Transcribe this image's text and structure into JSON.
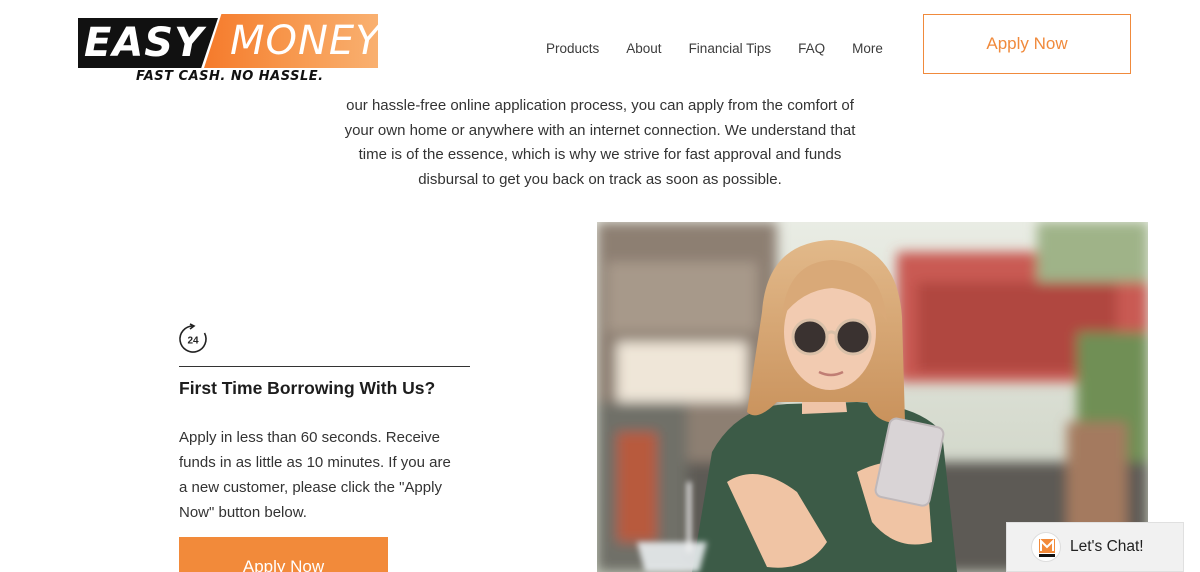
{
  "brand": {
    "logo_word1": "EASY",
    "logo_word2": "MONEY",
    "tagline": "FAST CASH. NO HASSLE.",
    "accent_color": "#f28a3a"
  },
  "nav": {
    "items": [
      {
        "label": "Products"
      },
      {
        "label": "About"
      },
      {
        "label": "Financial Tips"
      },
      {
        "label": "FAQ"
      },
      {
        "label": "More"
      }
    ]
  },
  "header": {
    "apply_label": "Apply Now"
  },
  "intro": {
    "lines": [
      "our hassle-free online application process, you can apply from the comfort of",
      "your own home or anywhere with an internet connection. We understand that",
      "time is of the essence, which is why we strive for fast approval and funds",
      "disbursal to get you back on track as soon as possible."
    ]
  },
  "feature": {
    "icon": "clock-24-icon",
    "icon_text": "24",
    "title": "First Time Borrowing With Us?",
    "lines": [
      "Apply in less than 60 seconds. Receive",
      "funds in as little as 10 minutes. If you are",
      "a new customer, please click the \"Apply",
      "Now\" button below."
    ],
    "apply_label": "Apply Now"
  },
  "photo": {
    "icon": "woman-with-phone-photo"
  },
  "chat": {
    "label": "Let's Chat!",
    "icon": "chat-avatar-icon"
  }
}
